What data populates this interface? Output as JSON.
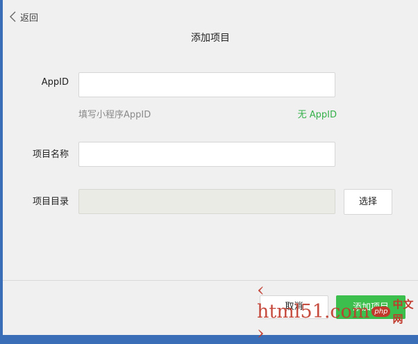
{
  "header": {
    "back_label": "返回",
    "title": "添加项目"
  },
  "form": {
    "appid_label": "AppID",
    "appid_value": "",
    "appid_hint": "填写小程序AppID",
    "no_appid_link": "无 AppID",
    "name_label": "项目名称",
    "name_value": "",
    "dir_label": "项目目录",
    "dir_value": "",
    "select_button": "选择"
  },
  "footer": {
    "cancel_button": "取消",
    "add_button": "添加项目"
  },
  "watermark": {
    "text": "‹ html51.com ›",
    "php": "php",
    "cn": "中文网"
  },
  "colors": {
    "accent_green": "#3cbf4d",
    "link_green": "#35b04a",
    "watermark_red": "#c0392b"
  }
}
